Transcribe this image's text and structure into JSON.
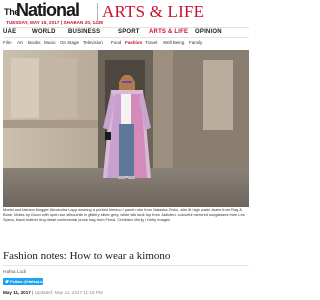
{
  "masthead": {
    "logo_small": "The",
    "logo_name": "National",
    "section_title": "ARTS & LIFE",
    "dateline": "TUESDAY, MAY 16, 2017 | SHABAN 20, 1438"
  },
  "main_nav": {
    "items": [
      {
        "label": "UAE"
      },
      {
        "label": "WORLD"
      },
      {
        "label": "BUSINESS"
      },
      {
        "label": "SPORT"
      },
      {
        "label": "ARTS & LIFE"
      },
      {
        "label": "OPINION"
      }
    ],
    "active": "ARTS & LIFE"
  },
  "sub_nav": {
    "items": [
      {
        "label": "Film"
      },
      {
        "label": "Art"
      },
      {
        "label": "Books"
      },
      {
        "label": "Music"
      },
      {
        "label": "On Stage"
      },
      {
        "label": "Television"
      },
      {
        "label": "Food"
      },
      {
        "label": "Fashion"
      },
      {
        "label": "Travel"
      },
      {
        "label": "Well Being"
      },
      {
        "label": "Family"
      }
    ],
    "active": "Fashion"
  },
  "article": {
    "caption": "Model and fashion blogger Alexandra Lapp wearing a printed kimono / panel robe from Natasha Zinko, slim fit high waist Jeans from Rag & Bone, Mules by Gucci with open-toe silhouette in glittery silver grey, white silk tank top from Jadicted, colourful mirrored sunglasses from Les Specs, black leather ring detail contenental purse bag from Fendi. Christian Vierig / Getty Images",
    "headline": "Fashion notes: How to wear a kimono",
    "author": "Hafsa Lodi",
    "follow_label": "Follow @HafsaLodi",
    "published_date": "May 11, 2017",
    "updated_text": "Updated: May 11, 2017 11:16 PM"
  },
  "colors": {
    "brand_red": "#c8102e",
    "twitter_blue": "#1da1f2"
  }
}
